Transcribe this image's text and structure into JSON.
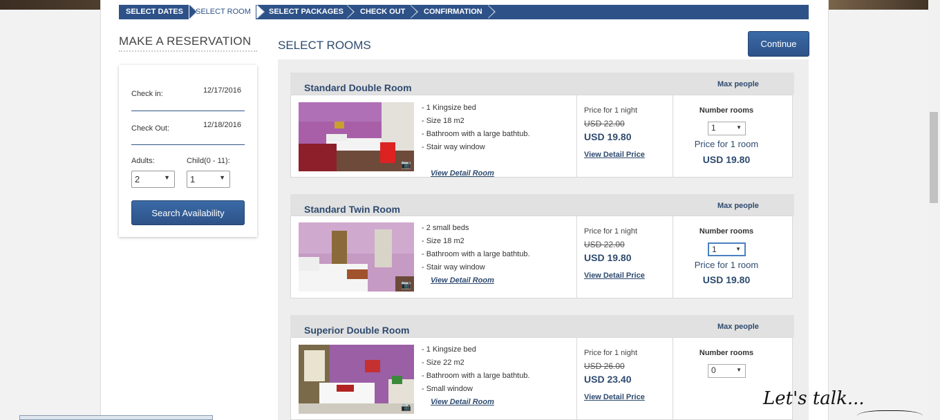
{
  "steps": [
    "SELECT DATES",
    "SELECT ROOM",
    "SELECT PACKAGES",
    "CHECK OUT",
    "CONFIRMATION"
  ],
  "active_step": 1,
  "reservation": {
    "title": "MAKE A RESERVATION",
    "checkin_label": "Check in:",
    "checkin_value": "12/17/2016",
    "checkout_label": "Check Out:",
    "checkout_value": "12/18/2016",
    "adults_label": "Adults:",
    "adults_value": "2",
    "child_label": "Child(0 - 11):",
    "child_value": "1",
    "search_button": "Search Availability"
  },
  "main": {
    "title": "SELECT ROOMS",
    "continue_button": "Continue"
  },
  "labels": {
    "max_people": "Max people",
    "price_for_night": "Price for 1 night",
    "view_detail_room": "View Detail Room",
    "view_detail_price": "View Detail Price",
    "number_rooms": "Number rooms",
    "price_for_room": "Price for 1 room"
  },
  "rooms": [
    {
      "name": "Standard Double Room",
      "features": [
        "- 1 Kingsize bed",
        "- Size 18 m2",
        "- Bathroom with a large bathtub.",
        "- Stair way window"
      ],
      "old_price": "USD 22.00",
      "new_price": "USD 19.80",
      "number_rooms": "1",
      "room_price": "USD 19.80"
    },
    {
      "name": "Standard Twin Room",
      "features": [
        "- 2 small beds",
        "- Size 18 m2",
        "- Bathroom with a large bathtub.",
        "- Stair way window"
      ],
      "old_price": "USD 22.00",
      "new_price": "USD 19.80",
      "number_rooms": "1",
      "room_price": "USD 19.80"
    },
    {
      "name": "Superior Double Room",
      "features": [
        "- 1 Kingsize bed",
        "- Size 22 m2",
        "- Bathroom with a large bathtub.",
        "- Small window"
      ],
      "old_price": "USD 26.00",
      "new_price": "USD 23.40",
      "number_rooms": "0",
      "room_price": ""
    }
  ],
  "lets_talk": "Let's talk...",
  "icons": {
    "camera": "camera-icon",
    "dropdown": "chevron-down-icon"
  }
}
